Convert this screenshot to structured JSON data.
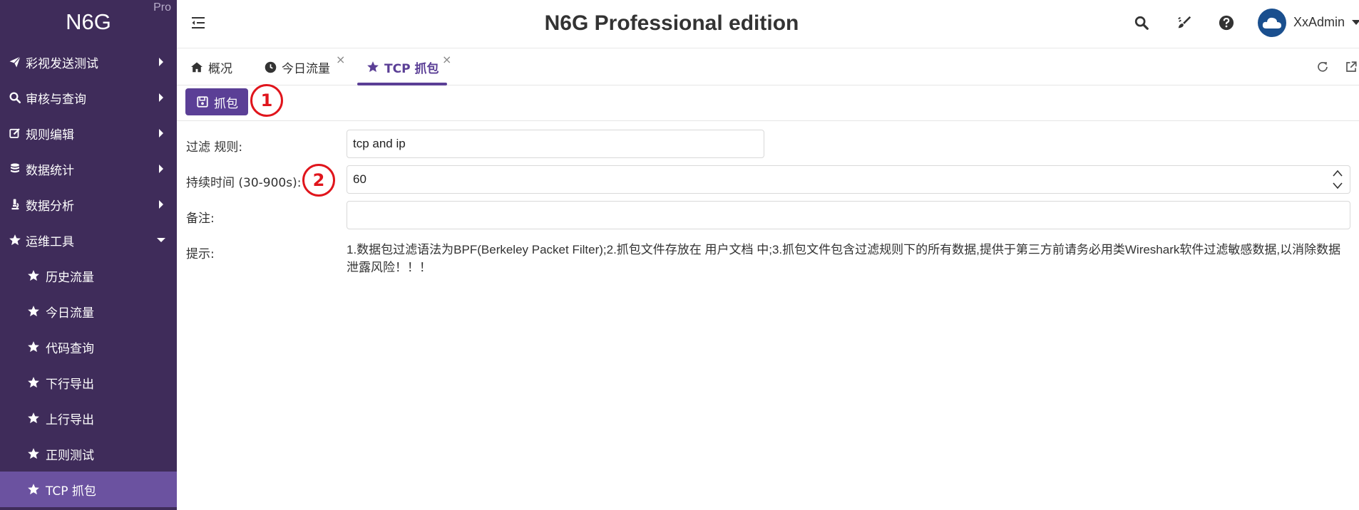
{
  "brand": {
    "name": "N6G",
    "badge": "Pro"
  },
  "sidebar": {
    "items": [
      {
        "label": "彩视发送测试",
        "icon": "paper-plane-icon",
        "expanded": false
      },
      {
        "label": "审核与查询",
        "icon": "search-icon",
        "expanded": false
      },
      {
        "label": "规则编辑",
        "icon": "edit-icon",
        "expanded": false
      },
      {
        "label": "数据统计",
        "icon": "database-icon",
        "expanded": false
      },
      {
        "label": "数据分析",
        "icon": "microscope-icon",
        "expanded": false
      },
      {
        "label": "运维工具",
        "icon": "star-icon",
        "expanded": true
      }
    ],
    "sub_items": [
      {
        "label": "历史流量"
      },
      {
        "label": "今日流量"
      },
      {
        "label": "代码查询"
      },
      {
        "label": "下行导出"
      },
      {
        "label": "上行导出"
      },
      {
        "label": "正则测试"
      },
      {
        "label": "TCP 抓包",
        "active": true
      }
    ]
  },
  "header": {
    "title": "N6G Professional edition",
    "user": "XxAdmin"
  },
  "tabs": [
    {
      "label": "概况",
      "icon": "home-icon",
      "closable": false,
      "active": false
    },
    {
      "label": "今日流量",
      "icon": "clock-icon",
      "closable": true,
      "active": false
    },
    {
      "label": "TCP 抓包",
      "icon": "star-icon",
      "closable": true,
      "active": true
    }
  ],
  "tab_close_glyph": "×",
  "toolbar": {
    "capture_label": "抓包"
  },
  "callouts": {
    "one": "1",
    "two": "2"
  },
  "form": {
    "filter_label": "过滤 规则:",
    "filter_value": "tcp and ip",
    "duration_label": "持续时间 (30-900s):",
    "duration_value": "60",
    "note_label": "备注:",
    "note_value": "",
    "hint_label": "提示:",
    "hint_text": "1.数据包过滤语法为BPF(Berkeley Packet Filter);2.抓包文件存放在 用户文档 中;3.抓包文件包含过滤规则下的所有数据,提供于第三方前请务必用类Wireshark软件过滤敏感数据,以消除数据泄露风险！！！"
  },
  "colors": {
    "sidebar_bg": "#3f2c5a",
    "accent": "#5b3f96",
    "active_item": "#6b52a0",
    "callout": "#e0151c"
  }
}
